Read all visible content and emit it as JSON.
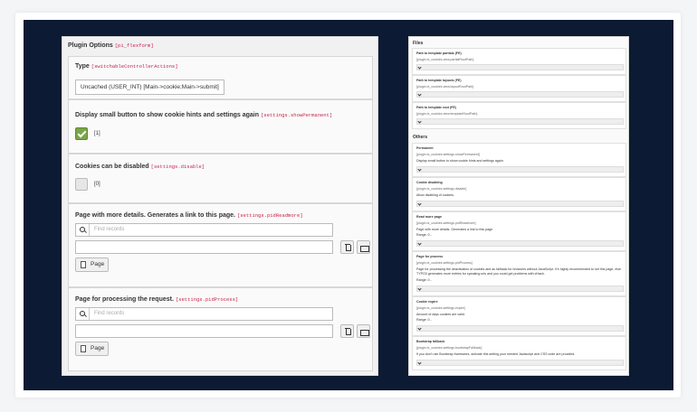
{
  "left": {
    "plugin_title": "Plugin Options",
    "plugin_code": "[pi_flexform]",
    "type": {
      "title": "Type",
      "code": "[switchableControllerActions]",
      "value": "Uncached (USER_INT) [Main->cookie;Main->submit]"
    },
    "show_permanent": {
      "title": "Display small button to show cookie hints and settings again",
      "code": "[settings.showPermanent]",
      "value": "[1]"
    },
    "disable": {
      "title": "Cookies can be disabled",
      "code": "[settings.disable]",
      "value": "[0]"
    },
    "readmore": {
      "title": "Page with more details. Generates a link to this page.",
      "code": "[settings.pidReadmore]",
      "placeholder": "Find records",
      "button": "Page"
    },
    "process": {
      "title": "Page for processing the request.",
      "code": "[settings.pidProcess]",
      "placeholder": "Find records",
      "button": "Page"
    }
  },
  "right": {
    "files_label": "Files",
    "others_label": "Others",
    "files": [
      {
        "title": "Path to template partials (FE)",
        "code": "[plugin.tx_cookies.view.partialRootPath]"
      },
      {
        "title": "Path to template layouts (FE)",
        "code": "[plugin.tx_cookies.view.layoutRootPath]"
      },
      {
        "title": "Path to template root (FE)",
        "code": "[plugin.tx_cookies.view.templateRootPath]"
      }
    ],
    "others": [
      {
        "title": "Permanent",
        "code": "[plugin.tx_cookies.settings.showPermanent]",
        "desc": "Display small button to show cookie hints and settings again."
      },
      {
        "title": "Cookie disabling",
        "code": "[plugin.tx_cookies.settings.disable]",
        "desc": "Allow disabling of cookies."
      },
      {
        "title": "Read more page",
        "code": "[plugin.tx_cookies.settings.pidReadmore]",
        "desc": "Page with more details. Generates a link to this page.",
        "range": "Range: 0 -"
      },
      {
        "title": "Page for process",
        "code": "[plugin.tx_cookies.settings.pidProcess]",
        "desc": "Page for processing the deactivation of cookies and as fallback for browsers without JavaScript. It's highly recommended to set this page, else TYPO3 generates more entries for speaking urls and you could get problems with cHash.",
        "range": "Range: 0 -"
      },
      {
        "title": "Cookie expire",
        "code": "[plugin.tx_cookies.settings.expire]",
        "desc": "Amount of days cookies are valid.",
        "range": "Range: 0 -"
      },
      {
        "title": "Bootstrap fallback",
        "code": "[plugin.tx_cookies.settings.bootstrapFallback]",
        "desc": "If you don't use Bootstrap framework, activate this setting your needed Javascript and CSS code are provided."
      }
    ]
  }
}
